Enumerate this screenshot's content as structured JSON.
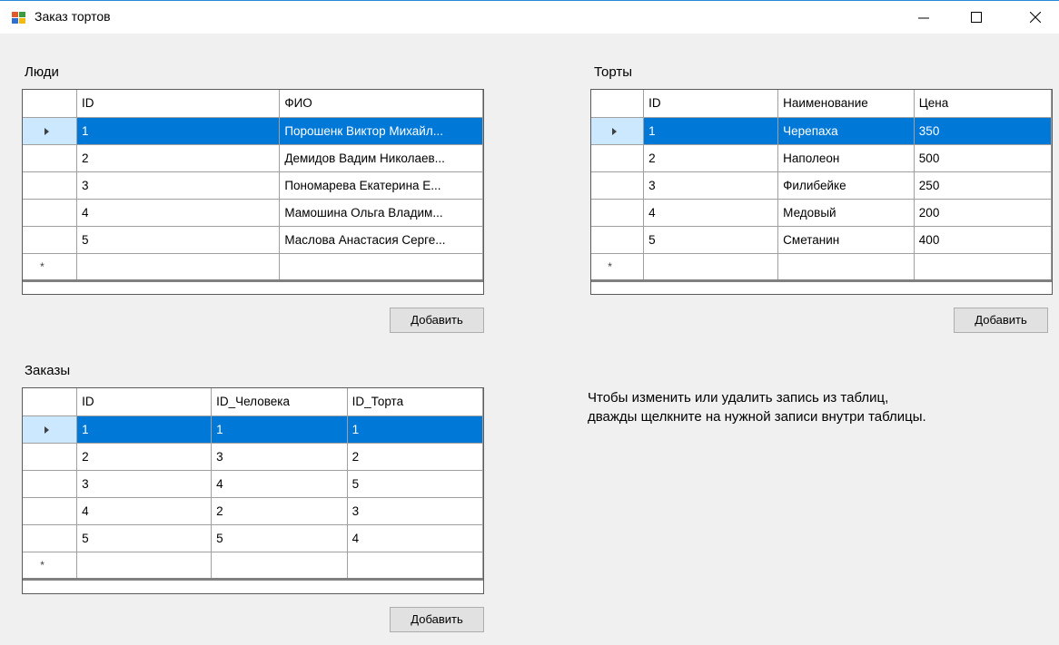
{
  "window": {
    "title": "Заказ тортов"
  },
  "people": {
    "label": "Люди",
    "columns": [
      "ID",
      "ФИО"
    ],
    "rows": [
      [
        "1",
        "Порошенк Виктор Михайл..."
      ],
      [
        "2",
        "Демидов Вадим Николаев..."
      ],
      [
        "3",
        "Пономарева Екатерина Е..."
      ],
      [
        "4",
        "Мамошина Ольга Владим..."
      ],
      [
        "5",
        "Маслова Анастасия Серге..."
      ]
    ],
    "add_button": "Добавить"
  },
  "cakes": {
    "label": "Торты",
    "columns": [
      "ID",
      "Наименование",
      "Цена"
    ],
    "rows": [
      [
        "1",
        "Черепаха",
        "350"
      ],
      [
        "2",
        "Наполеон",
        "500"
      ],
      [
        "3",
        "Филибейке",
        "250"
      ],
      [
        "4",
        "Медовый",
        "200"
      ],
      [
        "5",
        "Сметанин",
        "400"
      ]
    ],
    "add_button": "Добавить"
  },
  "orders": {
    "label": "Заказы",
    "columns": [
      "ID",
      "ID_Человека",
      "ID_Торта"
    ],
    "rows": [
      [
        "1",
        "1",
        "1"
      ],
      [
        "2",
        "3",
        "2"
      ],
      [
        "3",
        "4",
        "5"
      ],
      [
        "4",
        "2",
        "3"
      ],
      [
        "5",
        "5",
        "4"
      ]
    ],
    "add_button": "Добавить"
  },
  "hint": {
    "line1": "Чтобы изменить или удалить запись из таблиц,",
    "line2": "дважды щелкните на нужной записи внутри таблицы."
  },
  "new_row_marker": "*",
  "colors": {
    "selection": "#0078d7",
    "row_header_selected": "#cce8ff",
    "button_face": "#e1e1e1",
    "window_background": "#f0f0f0",
    "title_accent": "#2b88d8"
  },
  "icons": [
    "app-icon",
    "minimize-icon",
    "maximize-icon",
    "close-icon",
    "current-row-arrow-icon",
    "new-row-star-icon"
  ]
}
